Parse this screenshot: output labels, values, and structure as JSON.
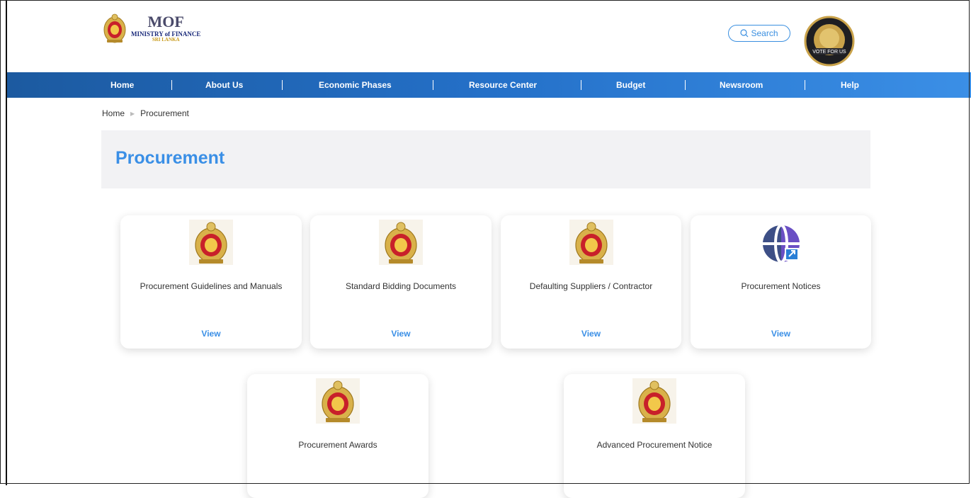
{
  "header": {
    "logo": {
      "mof": "MOF",
      "ministry": "MINISTRY of FINANCE",
      "country": "SRI LANKA"
    },
    "search_label": "Search",
    "badge_text": "VOTE FOR US"
  },
  "nav": {
    "items": [
      "Home",
      "About Us",
      "Economic Phases",
      "Resource Center",
      "Budget",
      "Newsroom",
      "Help"
    ]
  },
  "breadcrumb": {
    "home": "Home",
    "current": "Procurement"
  },
  "page": {
    "title": "Procurement"
  },
  "cards": [
    {
      "title": "Procurement Guidelines and Manuals",
      "link": "View",
      "icon": "national-emblem-icon"
    },
    {
      "title": "Standard Bidding Documents",
      "link": "View",
      "icon": "national-emblem-icon"
    },
    {
      "title": "Defaulting Suppliers / Contractor",
      "link": "View",
      "icon": "national-emblem-icon"
    },
    {
      "title": "Procurement Notices",
      "link": "View",
      "icon": "globe-link-icon"
    },
    {
      "title": "Procurement Awards",
      "link": "",
      "icon": "national-emblem-icon"
    },
    {
      "title": "Advanced Procurement Notice",
      "link": "",
      "icon": "national-emblem-icon"
    }
  ],
  "colors": {
    "accent": "#3a8fe6",
    "nav_start": "#1c5aa0",
    "nav_end": "#3b8fe6",
    "title_band": "#f2f2f4"
  }
}
